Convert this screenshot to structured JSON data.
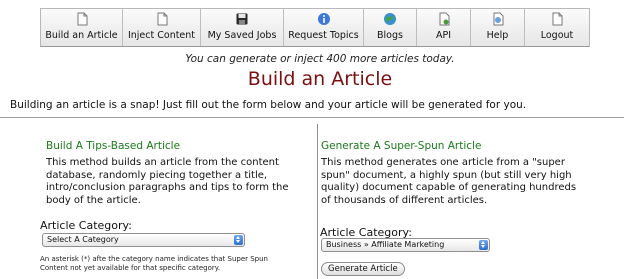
{
  "nav": {
    "items": [
      {
        "label": "Build an Article",
        "icon": "document-icon"
      },
      {
        "label": "Inject Content",
        "icon": "document-icon"
      },
      {
        "label": "My Saved Jobs",
        "icon": "floppy-disk-icon"
      },
      {
        "label": "Request Topics",
        "icon": "info-icon"
      },
      {
        "label": "Blogs",
        "icon": "globe-icon"
      },
      {
        "label": "API",
        "icon": "document-gear-icon"
      },
      {
        "label": "Help",
        "icon": "help-icon"
      },
      {
        "label": "Logout",
        "icon": "document-icon"
      }
    ]
  },
  "quota_text": "You can generate or inject 400 more articles today.",
  "page_title": "Build an Article",
  "intro_text": "Building an article is a snap! Just fill out the form below and your article will be generated for you.",
  "left": {
    "title": "Build A Tips-Based Article",
    "description": "This method builds an article from the content database, randomly piecing together a title, intro/conclusion paragraphs and tips to form the body of the article.",
    "category_label": "Article Category:",
    "category_selected": "Select A Category",
    "note": "An asterisk (*) afte the category name indicates that Super Spun Content not yet available for that specific category."
  },
  "right": {
    "title": "Generate A Super-Spun Article",
    "description": "This method generates one article from a \"super spun\" document, a highly spun (but still very high quality) document capable of generating hundreds of thousands of different articles.",
    "category_label": "Article Category:",
    "category_selected": "Business » Affiliate Marketing",
    "generate_button": "Generate Article"
  },
  "colors": {
    "title_red": "#7a1111",
    "section_green": "#1b7a1b",
    "select_arrow_blue": "#2f6fd0"
  }
}
